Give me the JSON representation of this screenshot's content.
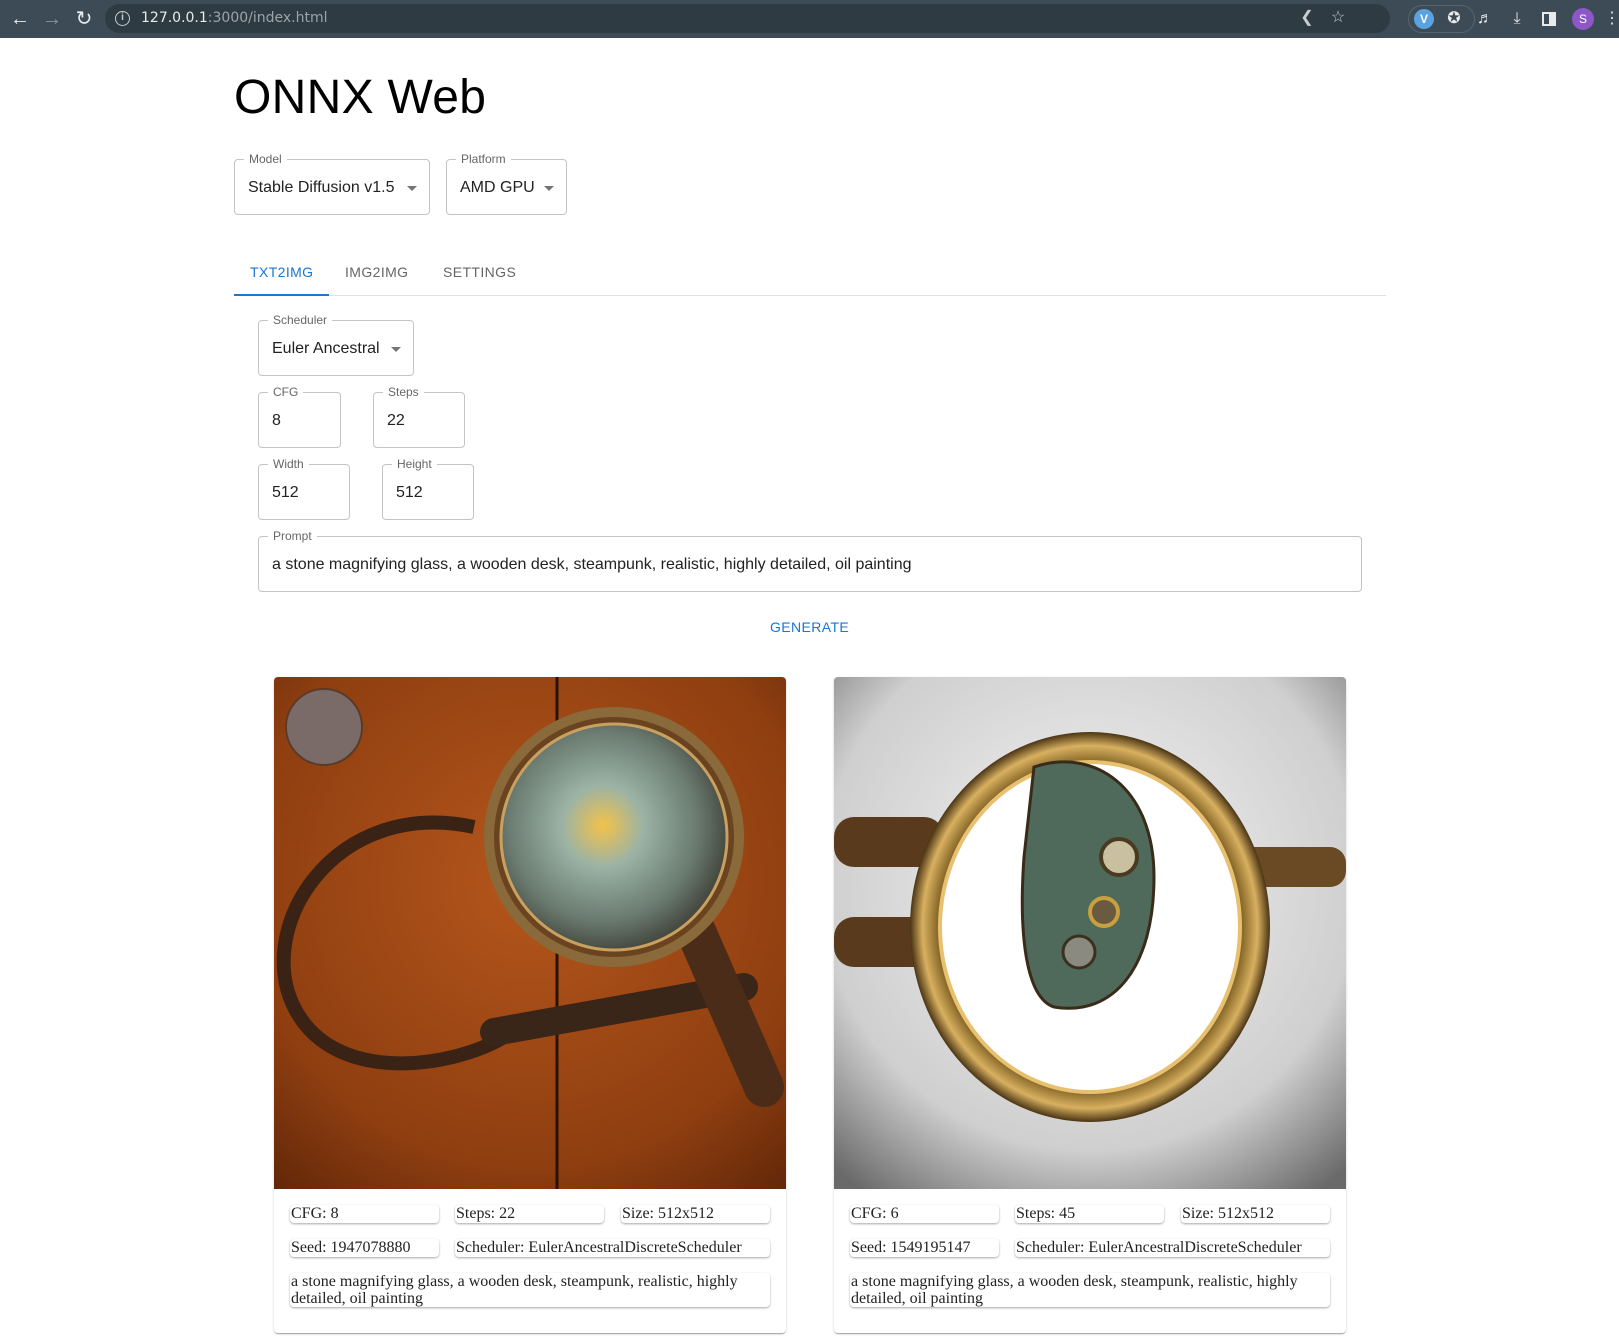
{
  "browser": {
    "url_host": "127.0.0.1",
    "url_rest": ":3000/index.html",
    "profile_initial": "S",
    "icons": {
      "back": "arrow-left",
      "forward": "arrow-right",
      "reload": "reload",
      "site_info": "info-circle",
      "share": "share",
      "bookmark": "star",
      "extension_vpn": "v-badge",
      "extensions": "puzzle-piece",
      "media": "playlist-music",
      "downloads": "download",
      "side_panel": "side-panel",
      "menu": "kebab"
    }
  },
  "app": {
    "title": "ONNX Web",
    "accent_color": "#1976d2"
  },
  "model_select": {
    "label": "Model",
    "value": "Stable Diffusion v1.5"
  },
  "platform_select": {
    "label": "Platform",
    "value": "AMD GPU"
  },
  "tabs": [
    {
      "label": "TXT2IMG",
      "active": true
    },
    {
      "label": "IMG2IMG",
      "active": false
    },
    {
      "label": "SETTINGS",
      "active": false
    }
  ],
  "form": {
    "scheduler": {
      "label": "Scheduler",
      "value": "Euler Ancestral"
    },
    "cfg": {
      "label": "CFG",
      "value": "8"
    },
    "steps": {
      "label": "Steps",
      "value": "22"
    },
    "width": {
      "label": "Width",
      "value": "512"
    },
    "height": {
      "label": "Height",
      "value": "512"
    },
    "prompt": {
      "label": "Prompt",
      "value": "a stone magnifying glass, a wooden desk, steampunk, realistic, highly detailed, oil painting"
    },
    "generate_label": "GENERATE"
  },
  "results": [
    {
      "image_alt": "steampunk magnifying glass on wooden desk",
      "cfg": "CFG: 8",
      "steps": "Steps: 22",
      "size": "Size: 512x512",
      "seed": "Seed: 1947078880",
      "scheduler": "Scheduler: EulerAncestralDiscreteScheduler",
      "prompt": "a stone magnifying glass, a wooden desk, steampunk, realistic, highly detailed, oil painting"
    },
    {
      "image_alt": "brass magnifying glass with mechanical lens",
      "cfg": "CFG: 6",
      "steps": "Steps: 45",
      "size": "Size: 512x512",
      "seed": "Seed: 1549195147",
      "scheduler": "Scheduler: EulerAncestralDiscreteScheduler",
      "prompt": "a stone magnifying glass, a wooden desk, steampunk, realistic, highly detailed, oil painting"
    }
  ]
}
